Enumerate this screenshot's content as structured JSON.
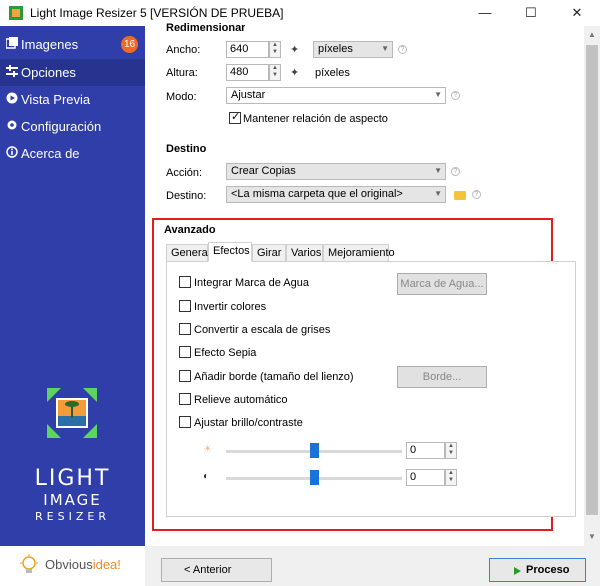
{
  "window": {
    "title": "Light Image Resizer 5  [VERSIÓN DE PRUEBA]"
  },
  "sidebar": {
    "items": [
      {
        "label": "Imagenes",
        "badge": "16",
        "icon": "images-icon"
      },
      {
        "label": "Opciones",
        "icon": "options-icon"
      },
      {
        "label": "Vista Previa",
        "icon": "preview-icon"
      },
      {
        "label": "Configuración",
        "icon": "gear-icon"
      },
      {
        "label": "Acerca de",
        "icon": "info-icon"
      }
    ],
    "logo_lines": [
      "LIGHT",
      "IMAGE",
      "RESIZER"
    ],
    "brand_prefix": "Obvious",
    "brand_suffix": "idea!"
  },
  "resize": {
    "section_title": "Redimensionar",
    "width_label": "Ancho:",
    "width_value": "640",
    "height_label": "Altura:",
    "height_value": "480",
    "unit_select": "píxeles",
    "unit_text": "píxeles",
    "mode_label": "Modo:",
    "mode_value": "Ajustar",
    "keep_aspect_label": "Mantener relación de aspecto",
    "keep_aspect_checked": true
  },
  "destination": {
    "section_title": "Destino",
    "action_label": "Acción:",
    "action_value": "Crear Copias",
    "dest_label": "Destino:",
    "dest_value": "<La misma carpeta que el original>"
  },
  "advanced": {
    "section_title": "Avanzado",
    "tabs": [
      "General",
      "Efectos",
      "Girar",
      "Varios",
      "Mejoramiento"
    ],
    "active_tab": "Efectos",
    "options": [
      {
        "label": "Integrar Marca de Agua",
        "checked": false
      },
      {
        "label": "Invertir colores",
        "checked": false
      },
      {
        "label": "Convertir a escala de grises",
        "checked": false
      },
      {
        "label": "Efecto Sepia",
        "checked": false
      },
      {
        "label": "Añadir borde (tamaño del lienzo)",
        "checked": false
      },
      {
        "label": "Relieve automático",
        "checked": false
      },
      {
        "label": "Ajustar brillo/contraste",
        "checked": false
      }
    ],
    "watermark_button": "Marca de Agua...",
    "border_button": "Borde...",
    "brightness_value": "0",
    "contrast_value": "0",
    "brightness_level": 0.5,
    "contrast_level": 0.5
  },
  "footer": {
    "prev_label": "< Anterior",
    "process_label": "Proceso"
  },
  "colors": {
    "sidebar": "#2f3ea8",
    "highlight": "#e21d1d",
    "badge": "#f06a27",
    "accent": "#1a73d9"
  }
}
